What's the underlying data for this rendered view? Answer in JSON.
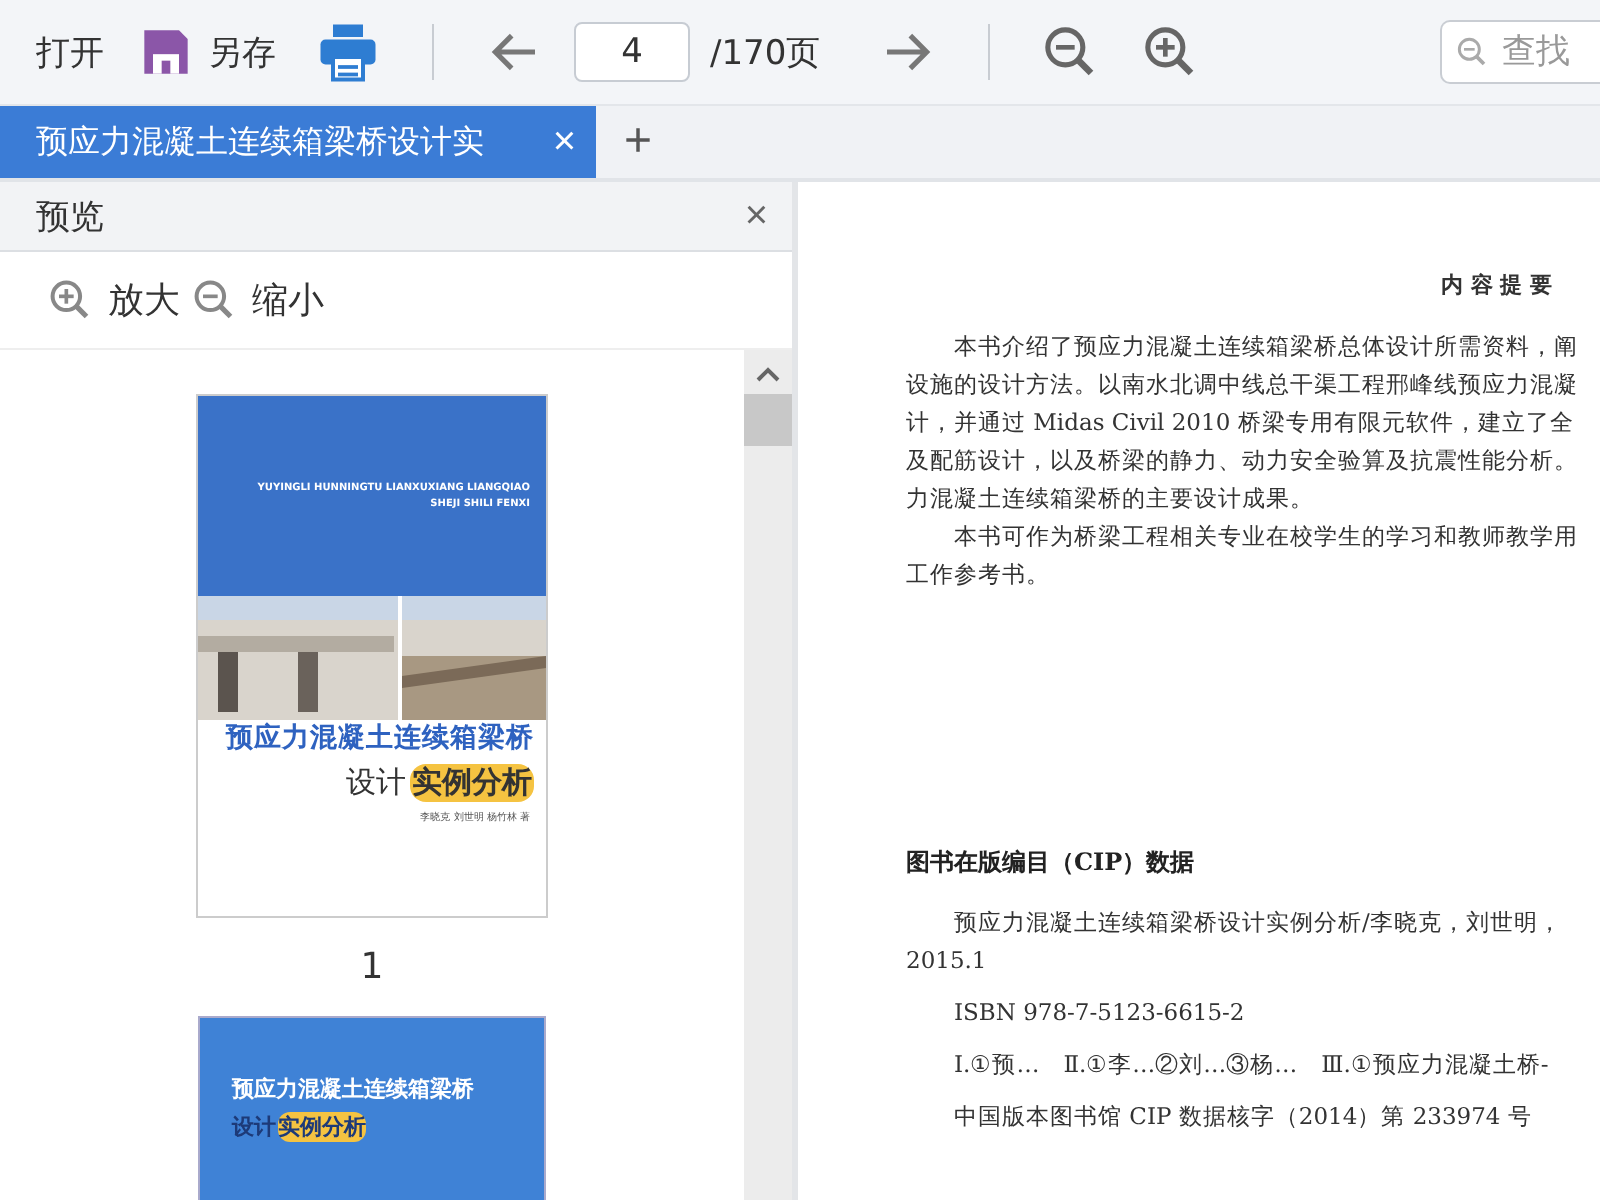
{
  "toolbar": {
    "open": "打开",
    "save_as": "另存",
    "page_input": "4",
    "page_total": "/170页",
    "search": {
      "placeholder": "查找"
    }
  },
  "tabs": [
    {
      "label": "预应力混凝土连续箱梁桥设计实",
      "selected": true,
      "close": "×"
    }
  ],
  "new_tab": "+",
  "preview": {
    "title": "预览",
    "close": "×",
    "zoom_in": "放大",
    "zoom_out": "缩小",
    "thumbnails": [
      {
        "kind": "cover",
        "pinyin": [
          "YUYINGLI HUNNINGTU LIANXUXIANG LIANGQIAO",
          "SHEJI SHILI FENXI"
        ],
        "title": "预应力混凝土连续箱梁桥",
        "subtitle": "设计",
        "highlight": "实例分析",
        "authors": "李晓克 刘世明 杨竹林 著",
        "number": "1"
      },
      {
        "kind": "inner",
        "title": "预应力混凝土连续箱梁桥",
        "subtitle": "设计",
        "highlight": "实例分析"
      }
    ]
  },
  "document": {
    "heading": "内 容 提 要",
    "paragraphs": [
      [
        "本书介绍了预应力混凝土连续箱梁桥总体设计所需资料，阐",
        "设施的设计方法。以南水北调中线总干渠工程邢峰线预应力混凝",
        "计，并通过 Midas Civil 2010 桥梁专用有限元软件，建立了全",
        "及配筋设计，以及桥梁的静力、动力安全验算及抗震性能分析。",
        "力混凝土连续箱梁桥的主要设计成果。"
      ],
      [
        "本书可作为桥梁工程相关专业在校学生的学习和教师教学用",
        "工作参考书。"
      ]
    ],
    "cip_heading": "图书在版编目（CIP）数据",
    "cip_lines": [
      [
        "预应力混凝土连续箱梁桥设计实例分析/李晓克，刘世明，",
        "2015.1"
      ],
      [
        "ISBN 978-7-5123-6615-2"
      ],
      [
        "Ⅰ.①预…　Ⅱ.①李…②刘…③杨…　Ⅲ.①预应力混凝土桥-"
      ],
      [
        "中国版本图书馆 CIP 数据核字（2014）第 233974 号"
      ]
    ]
  }
}
